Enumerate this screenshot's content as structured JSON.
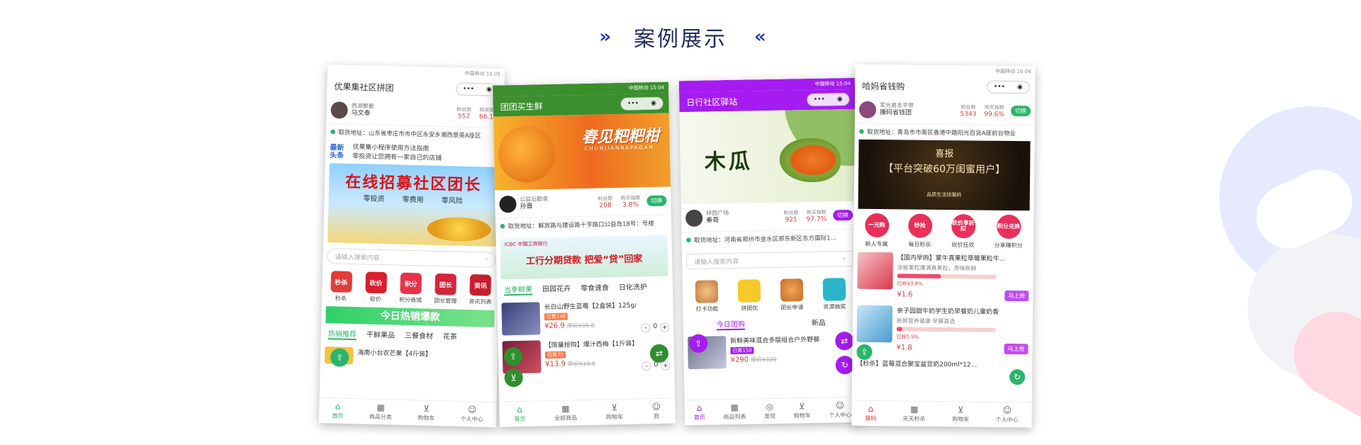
{
  "heading": {
    "title": "案例展示",
    "left_deco": "»",
    "right_deco": "«",
    "accent": "#2b3cc4"
  },
  "phone1": {
    "status": "中国移动 15:05",
    "title": "优果集社区拼团",
    "user": {
      "role": "西湖聚聚",
      "name": "马文泰"
    },
    "stats": [
      {
        "label": "粉丝数",
        "value": "557"
      },
      {
        "label": "购买指数",
        "value": "66.1%"
      }
    ],
    "addr": "取货地址：山东省枣庄市市中区永安乡潮西景英A座区",
    "news": {
      "tag1": "最新",
      "tag2": "头条",
      "line1": "优果集小程序使用方法指南",
      "line2": "零投资让您拥有一家自己的店铺"
    },
    "banner": {
      "title": "在线招募社区团长",
      "sub": "零投资 零费用 零风险"
    },
    "search_placeholder": "请输入搜索内容",
    "cats": [
      {
        "label": "秒杀",
        "icon": "秒杀"
      },
      {
        "label": "砍价",
        "icon": "砍价"
      },
      {
        "label": "积分商城",
        "icon": "积分"
      },
      {
        "label": "团长管理",
        "icon": "团长"
      },
      {
        "label": "资讯列表",
        "icon": "资讯"
      }
    ],
    "hot": "今日热销爆款",
    "tabs": [
      "热销推荐",
      "干鲜果品",
      "三餐食材",
      "花茶"
    ],
    "item": "海南小台农芒果【4斤装】",
    "tabbar": [
      "首页",
      "商品分类",
      "购物车",
      "个人中心"
    ]
  },
  "phone2": {
    "status": "中国移动 15:04",
    "title": "团团买生鲜",
    "banner": {
      "title": "春见粑粑柑",
      "sub": "CHUNJIANBAPAGAN"
    },
    "user": {
      "role": "公益后勤舍",
      "name": "孙晋"
    },
    "stats": [
      {
        "label": "粉丝数",
        "value": "208"
      },
      {
        "label": "购买指数",
        "value": "3.8%"
      }
    ],
    "switch": "切换",
    "addr": "取货地址：解放路与建设路十字路口公益岛18号：号楼",
    "bank": {
      "logo": "ICBC 中国工商银行",
      "title": "工行分期贷款 把爱“贷”回家"
    },
    "tabs": [
      "当季鲜果",
      "田园花卉",
      "零食速食",
      "日化洗护"
    ],
    "items": [
      {
        "name": "长白山野生蓝莓【2盒装】125g/每...",
        "tag": "已售148",
        "price": "¥26.9",
        "old": "原价¥35.8"
      },
      {
        "name": "【限量抢购】爆汁西梅【1斤装】...",
        "tag": "已售70",
        "price": "¥13.9",
        "old": "原价¥19.8"
      }
    ],
    "tabbar": [
      "首页",
      "全部商品",
      "购物车",
      "我"
    ]
  },
  "phone3": {
    "status": "中国移动 15:04",
    "title": "日行社区驿站",
    "banner": {
      "title": "木瓜"
    },
    "user": {
      "role": "祥园广场",
      "name": "秦哥"
    },
    "stats": [
      {
        "label": "粉丝数",
        "value": "921"
      },
      {
        "label": "购买指数",
        "value": "97.7%"
      }
    ],
    "switch": "切换",
    "addr": "取货地址：河南省郑州市金水区郑东新区东方国际1...",
    "search_placeholder": "请输入搜索内容",
    "quick": [
      "打卡功能",
      "拼团优",
      "团长申请",
      "资源抽奖"
    ],
    "sub": [
      "今日团购",
      "新品"
    ],
    "item": {
      "name": "新鲜美味混合多层组合户外野餐",
      "tag": "已售150",
      "price": "¥290",
      "old": "原价¥320"
    },
    "tabbar": [
      "首页",
      "商品列表",
      "发现",
      "购物车",
      "个人中心"
    ]
  },
  "phone4": {
    "status": "中国移动 16:04",
    "title": "哈妈省钱购",
    "user": {
      "role": "军光易支平带",
      "name": "播码省钱团"
    },
    "stats": [
      {
        "label": "粉丝数",
        "value": "5343"
      },
      {
        "label": "购买指数",
        "value": "99.6%"
      }
    ],
    "switch": "切换",
    "addr": "取货地址：青岛市市南区香港中路阳光百货A座前台物业",
    "banner": {
      "l1": "喜报",
      "l2": "【平台突破60万闺蜜用户】",
      "l3": "品质生活找猫妈"
    },
    "circles": [
      {
        "icon": "一元购",
        "label": "新人专属"
      },
      {
        "icon": "秒抢",
        "label": "每日秒杀"
      },
      {
        "icon": "砍价享折扣",
        "label": "砍价狂欢"
      },
      {
        "icon": "积分兑换",
        "label": "分享赚积分"
      }
    ],
    "items": [
      {
        "name": "【国内早购】蒙牛真果粒草莓果粒牛...",
        "desc": "浓郁果粒爆满真果粒，原味新鲜",
        "price": "¥1.6",
        "pct": "已抢43.8%",
        "fill": 0.44,
        "btn": "马上抢"
      },
      {
        "name": "亲子园甜牛奶学生奶早餐奶儿童奶香",
        "desc": "新鲜营养健康 早餐首选",
        "price": "¥1.8",
        "pct": "已抢5.9%",
        "fill": 0.06,
        "btn": "马上抢"
      }
    ],
    "item3": "【秒杀】蓝莓混合聚宝盆豆奶200ml*12...",
    "tabbar": [
      "猫妈",
      "天天秒杀",
      "购物车",
      "个人中心"
    ]
  }
}
